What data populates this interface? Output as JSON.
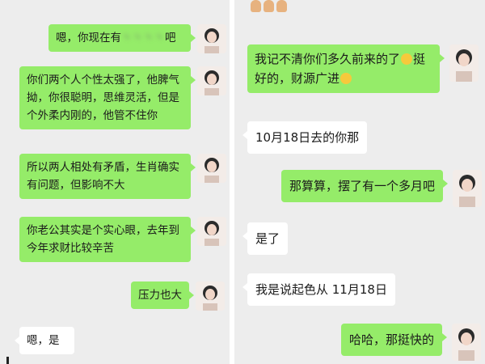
{
  "left_chat": {
    "messages": [
      {
        "side": "right",
        "text_before": "嗯，你现在有",
        "text_blurred": "丶丶丶丶",
        "text_after": "吧"
      },
      {
        "side": "right",
        "text": "你们两个人个性太强了，他脾气拗，你很聪明，思维灵活，但是个外柔内刚的，他管不住你"
      },
      {
        "side": "right",
        "text": "所以两人相处有矛盾，生肖确实有问题，但影响不大"
      },
      {
        "side": "right",
        "text": "你老公其实是个实心眼，去年到今年求财比较辛苦"
      },
      {
        "side": "right",
        "text": "压力也大"
      },
      {
        "side": "left",
        "text": "嗯，是"
      }
    ]
  },
  "right_chat": {
    "messages": [
      {
        "side": "right",
        "text": "我记不清你们多久前来的了",
        "text_after_emoji": "挺好的，财源广进"
      },
      {
        "side": "left",
        "text": "10月18日去的你那"
      },
      {
        "side": "right",
        "text": "那算算，摆了有一个多月吧"
      },
      {
        "side": "left",
        "text": "是了"
      },
      {
        "side": "left",
        "text": "我是说起色从 11月18日"
      },
      {
        "side": "right",
        "text": "哈哈，那挺快的"
      }
    ]
  },
  "colors": {
    "chat_background": "#ededed",
    "sent_bubble": "#95ec69",
    "received_bubble": "#ffffff"
  }
}
